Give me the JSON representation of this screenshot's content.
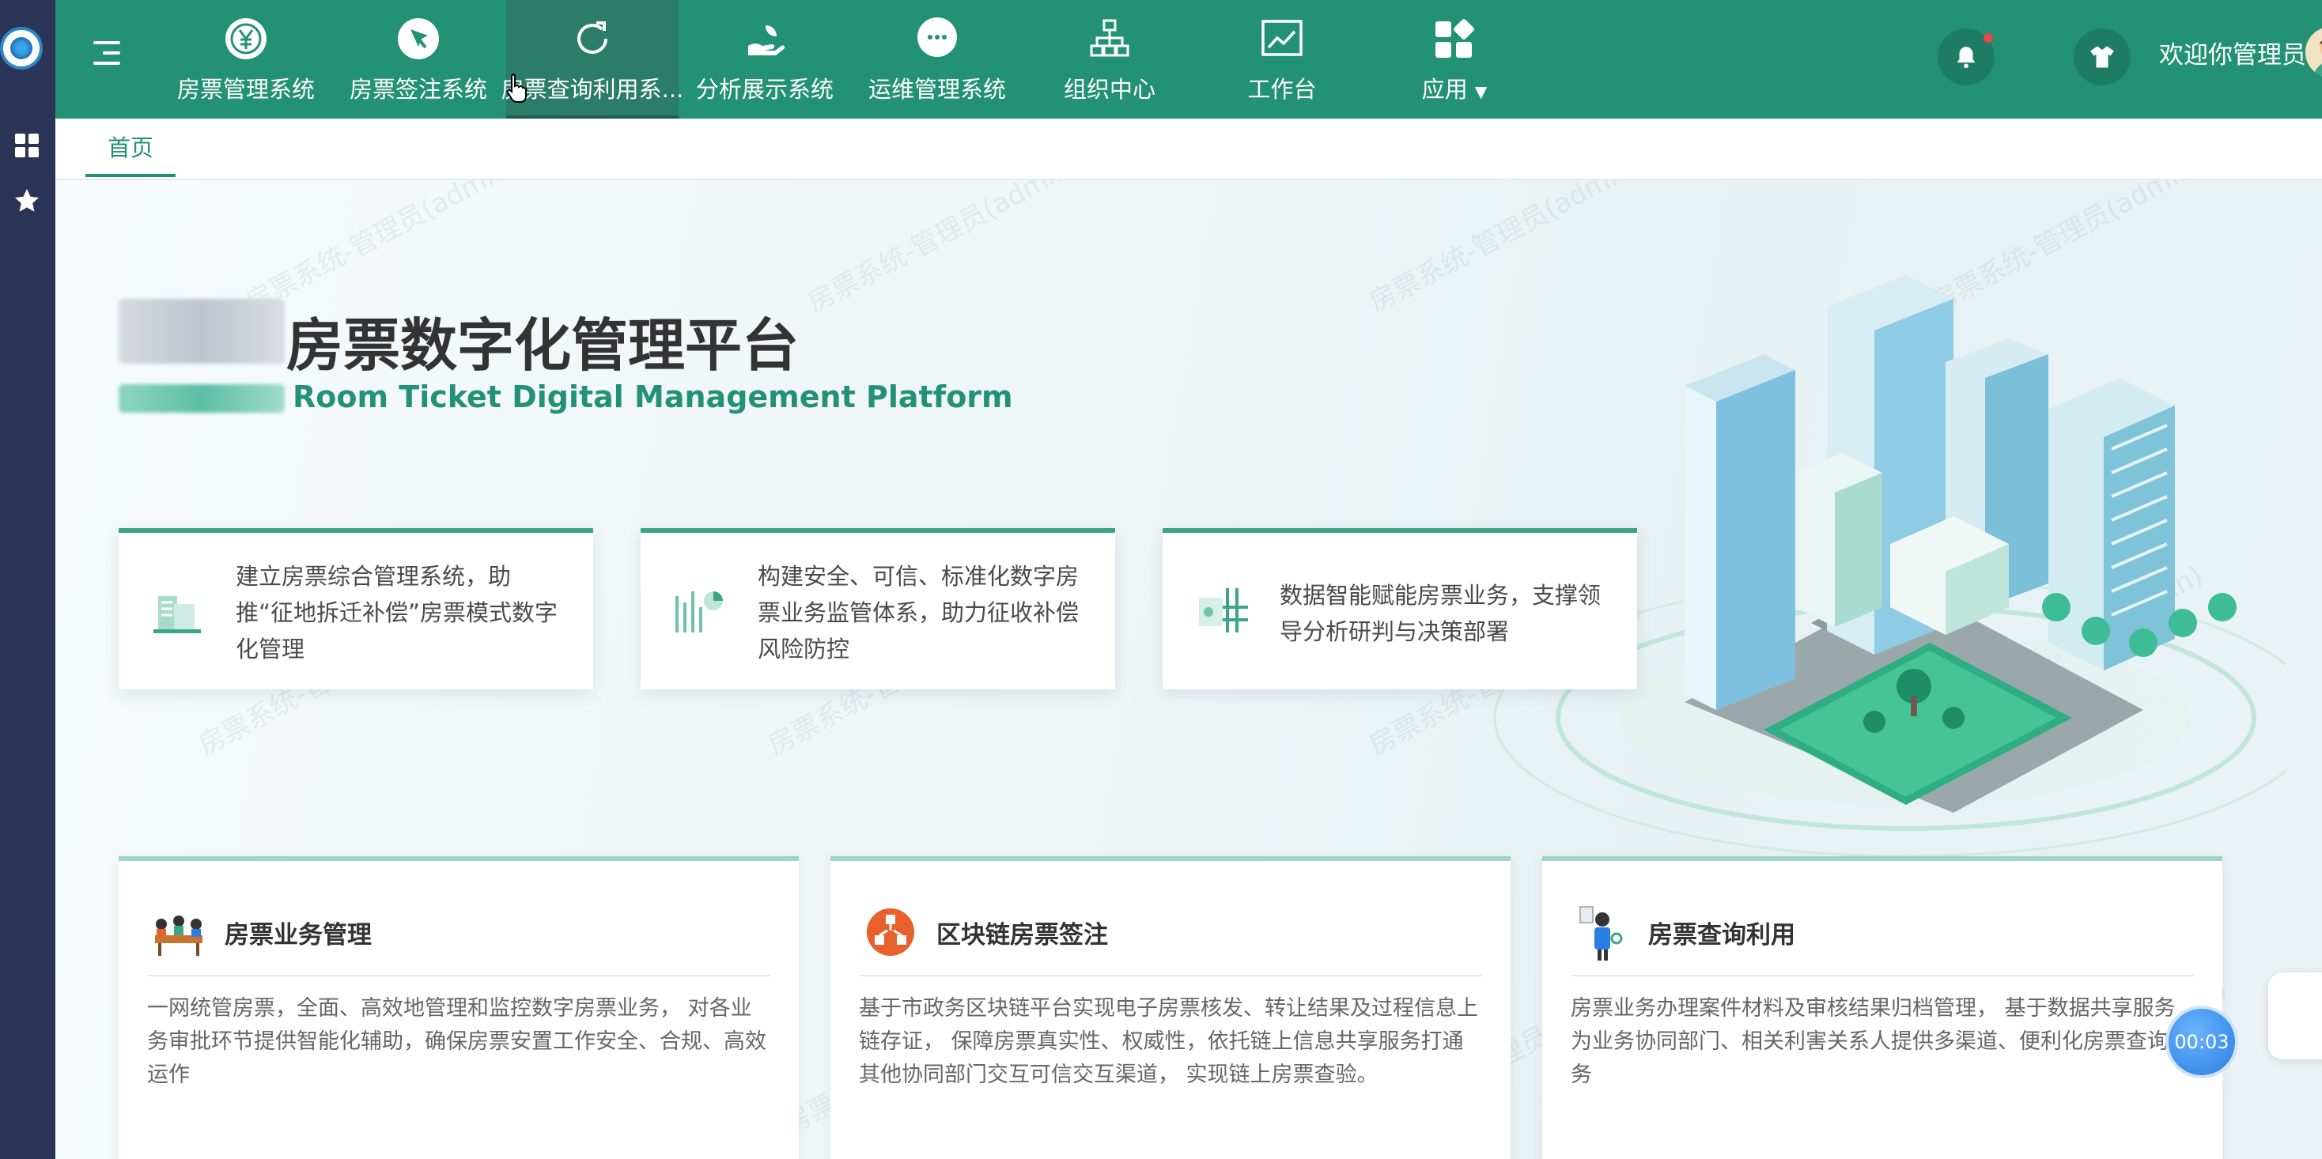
{
  "colors": {
    "primary": "#239173",
    "rail": "#2b3557",
    "accent_orange": "#e8602c"
  },
  "header": {
    "nav": [
      {
        "label": "房票管理系统",
        "icon": "yen-coin-icon"
      },
      {
        "label": "房票签注系统",
        "icon": "stamp-pen-icon"
      },
      {
        "label": "房票查询利用系...",
        "icon": "refresh-icon"
      },
      {
        "label": "分析展示系统",
        "icon": "hand-leaf-icon"
      },
      {
        "label": "运维管理系统",
        "icon": "chat-bubble-icon"
      },
      {
        "label": "组织中心",
        "icon": "org-chart-icon"
      },
      {
        "label": "工作台",
        "icon": "line-chart-icon"
      },
      {
        "label": "应用",
        "icon": "apps-grid-icon"
      }
    ],
    "welcome": "欢迎你管理员"
  },
  "tabs": {
    "home": "首页"
  },
  "hero": {
    "title": "房票数字化管理平台",
    "subtitle": "Room Ticket Digital Management Platform"
  },
  "features": [
    {
      "text": "建立房票综合管理系统，助推“征地拆迁补偿”房票模式数字化管理"
    },
    {
      "text": "构建安全、可信、标准化数字房票业务监管体系，助力征收补偿风险防控"
    },
    {
      "text": "数据智能赋能房票业务，支撑领导分析研判与决策部署"
    }
  ],
  "cards": [
    {
      "title": "房票业务管理",
      "desc": "一网统管房票，全面、高效地管理和监控数字房票业务， 对各业务审批环节提供智能化辅助，确保房票安置工作安全、合规、高效运作"
    },
    {
      "title": "区块链房票签注",
      "desc": "基于市政务区块链平台实现电子房票核发、转让结果及过程信息上链存证， 保障房票真实性、权威性，依托链上信息共享服务打通其他协同部门交互可信交互渠道， 实现链上房票查验。"
    },
    {
      "title": "房票查询利用",
      "desc": "房票业务办理案件材料及审核结果归档管理， 基于数据共享服务为业务协同部门、相关利害关系人提供多渠道、便利化房票查询服务"
    }
  ],
  "watermark": "房票系统-管理员(admin)",
  "timer": "00:03"
}
